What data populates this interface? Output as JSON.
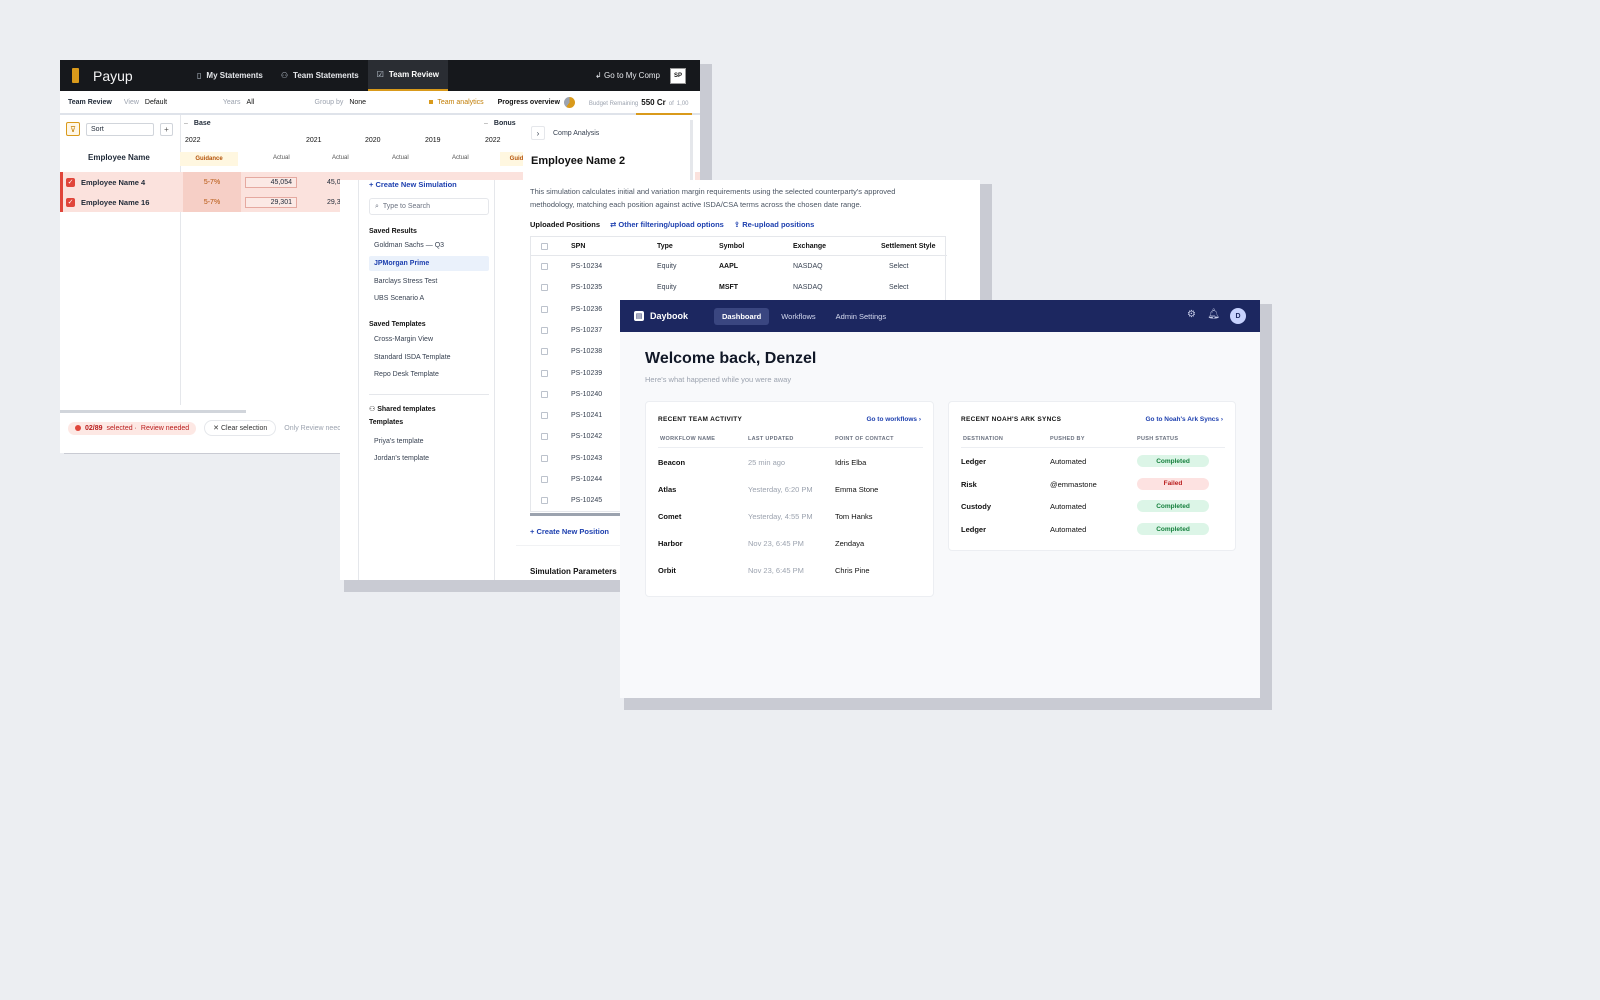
{
  "payup": {
    "brand": "Payup",
    "tabs": [
      {
        "label": "My Statements",
        "icon": "statements-icon"
      },
      {
        "label": "Team Statements",
        "icon": "team-icon"
      },
      {
        "label": "Team Review",
        "icon": "review-icon"
      }
    ],
    "active_tab": "Team Review",
    "go_to_comp": "Go to My Comp",
    "avatar": "SP",
    "toolbar": {
      "title": "Team Review",
      "view_label": "View",
      "view_value": "Default",
      "years_label": "Years",
      "years_value": "All",
      "groupby_label": "Group by",
      "groupby_value": "None",
      "analytics": "Team analytics",
      "progress": "Progress overview",
      "budget_label": "Budget Remaining",
      "budget_value": "550 Cr",
      "budget_of": "of",
      "budget_total": "1,00"
    },
    "grid": {
      "sort_placeholder": "Sort",
      "plus": "+",
      "employee_header": "Employee Name",
      "groups": [
        {
          "label": "Base",
          "chev": "–"
        },
        {
          "label": "Bonus",
          "chev": "–"
        }
      ],
      "years": [
        "2022",
        "2021",
        "2020",
        "2019",
        "2022"
      ],
      "subheaders": [
        "Guidance",
        "Actual",
        "Actual",
        "Actual",
        "Actual",
        "Guidan"
      ],
      "rows": [
        {
          "name": "Employee Name 4",
          "guidance": "5-7%",
          "actual": "45,054",
          "actual2": "45,0"
        },
        {
          "name": "Employee Name 16",
          "guidance": "5-7%",
          "actual": "29,301",
          "actual2": "29,3"
        }
      ]
    },
    "footer": {
      "selected": "02/89",
      "selected_suffix": "selected ·",
      "review": "Review needed",
      "clear": "Clear selection",
      "only": "Only Review neec"
    }
  },
  "comp": {
    "header": "Comp Analysis",
    "title": "Employee Name 2"
  },
  "sim": {
    "create": "+ Create New Simulation",
    "search_placeholder": "Type to Search",
    "saved_results_title": "Saved Results",
    "saved_results": [
      "Goldman Sachs — Q3",
      "JPMorgan Prime",
      "Barclays Stress Test",
      "UBS Scenario A"
    ],
    "selected_result": "JPMorgan Prime",
    "saved_templates_title": "Saved Templates",
    "saved_templates": [
      "Cross-Margin View",
      "Standard ISDA Template",
      "Repo Desk Template"
    ],
    "shared_title_1": "Shared templates",
    "shared_title_2": "Templates",
    "shared_templates": [
      "Priya's template",
      "Jordan's template"
    ],
    "description": "This simulation calculates initial and variation margin requirements using the selected counterparty's approved methodology, matching each position against active ISDA/CSA terms across the chosen date range.",
    "uploaded_title": "Uploaded Positions",
    "filter_link": "Other filtering/upload options",
    "reupload_link": "Re-upload positions",
    "columns": [
      "SPN",
      "Type",
      "Symbol",
      "Exchange",
      "Settlement Style"
    ],
    "rows": [
      {
        "spn": "PS-10234",
        "type": "Equity",
        "symbol": "AAPL",
        "exchange": "NASDAQ",
        "settle": "Select"
      },
      {
        "spn": "PS-10235",
        "type": "Equity",
        "symbol": "MSFT",
        "exchange": "NASDAQ",
        "settle": "Select"
      },
      {
        "spn": "PS-10236"
      },
      {
        "spn": "PS-10237"
      },
      {
        "spn": "PS-10238"
      },
      {
        "spn": "PS-10239"
      },
      {
        "spn": "PS-10240"
      },
      {
        "spn": "PS-10241"
      },
      {
        "spn": "PS-10242"
      },
      {
        "spn": "PS-10243"
      },
      {
        "spn": "PS-10244"
      },
      {
        "spn": "PS-10245"
      }
    ],
    "new_position": "+ Create New Position",
    "params_title": "Simulation Parameters"
  },
  "daybook": {
    "brand": "Daybook",
    "nav": [
      "Dashboard",
      "Workflows",
      "Admin Settings"
    ],
    "active_nav": "Dashboard",
    "avatar": "D",
    "welcome": "Welcome back, Denzel",
    "subtitle": "Here's what happened while you were away",
    "activity": {
      "title": "RECENT TEAM ACTIVITY",
      "link": "Go to workflows ›",
      "columns": [
        "WORKFLOW NAME",
        "LAST UPDATED",
        "POINT OF CONTACT"
      ],
      "rows": [
        {
          "name": "Beacon",
          "updated": "25 min ago",
          "contact": "Idris Elba"
        },
        {
          "name": "Atlas",
          "updated": "Yesterday, 6:20 PM",
          "contact": "Emma Stone"
        },
        {
          "name": "Comet",
          "updated": "Yesterday, 4:55 PM",
          "contact": "Tom Hanks"
        },
        {
          "name": "Harbor",
          "updated": "Nov 23, 6:45 PM",
          "contact": "Zendaya"
        },
        {
          "name": "Orbit",
          "updated": "Nov 23, 6:45 PM",
          "contact": "Chris Pine"
        }
      ]
    },
    "syncs": {
      "title": "RECENT NOAH'S ARK SYNCS",
      "link": "Go to Noah's Ark Syncs ›",
      "columns": [
        "DESTINATION",
        "PUSHED BY",
        "PUSH STATUS"
      ],
      "rows": [
        {
          "dest": "Ledger",
          "by": "Automated",
          "status": "Completed",
          "ok": true
        },
        {
          "dest": "Risk",
          "by": "@emmastone",
          "status": "Failed",
          "ok": false
        },
        {
          "dest": "Custody",
          "by": "Automated",
          "status": "Completed",
          "ok": true
        },
        {
          "dest": "Ledger",
          "by": "Automated",
          "status": "Completed",
          "ok": true
        }
      ]
    },
    "colors": {
      "navbar": "#1c2760",
      "success": "#15803d",
      "danger": "#b91c1c"
    }
  }
}
